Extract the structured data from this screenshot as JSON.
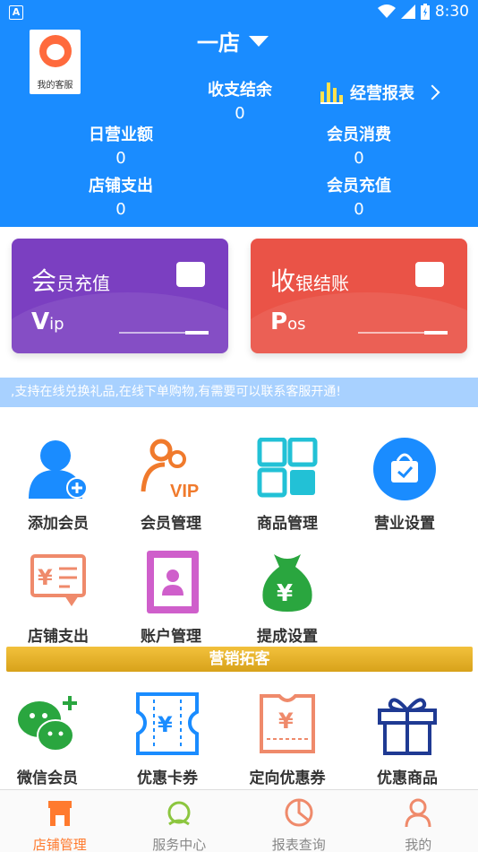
{
  "status_bar": {
    "time": "8:30"
  },
  "header": {
    "store_name": "一店",
    "customer_service_label": "我的客服",
    "balance_label": "收支结余",
    "balance_value": "0",
    "report_label": "经营报表",
    "daily_revenue_label": "日营业额",
    "daily_revenue_value": "0",
    "member_spend_label": "会员消费",
    "member_spend_value": "0",
    "store_expense_label": "店铺支出",
    "store_expense_value": "0",
    "member_recharge_label": "会员充值",
    "member_recharge_value": "0"
  },
  "cards": {
    "recharge": {
      "title_big": "会",
      "title_rest": "员充值",
      "sub_big": "V",
      "sub_rest": "ip",
      "color": "#7b3fc1"
    },
    "checkout": {
      "title_big": "收",
      "title_rest": "银结账",
      "sub_big": "P",
      "sub_rest": "os",
      "color": "#ea5347"
    }
  },
  "notice": ",支持在线兑换礼品,在线下单购物,有需要可以联系客服开通!",
  "grid": {
    "add_member": "添加会员",
    "member_manage": "会员管理",
    "goods_manage": "商品管理",
    "business_settings": "营业设置",
    "store_expense": "店铺支出",
    "account_manage": "账户管理",
    "commission_settings": "提成设置"
  },
  "marketing": {
    "banner": "营销拓客",
    "wechat_member": "微信会员",
    "discount_card": "优惠卡券",
    "targeted_coupon": "定向优惠券",
    "discount_goods": "优惠商品"
  },
  "tabs": {
    "store": "店铺管理",
    "service": "服务中心",
    "reports": "报表查询",
    "mine": "我的"
  }
}
